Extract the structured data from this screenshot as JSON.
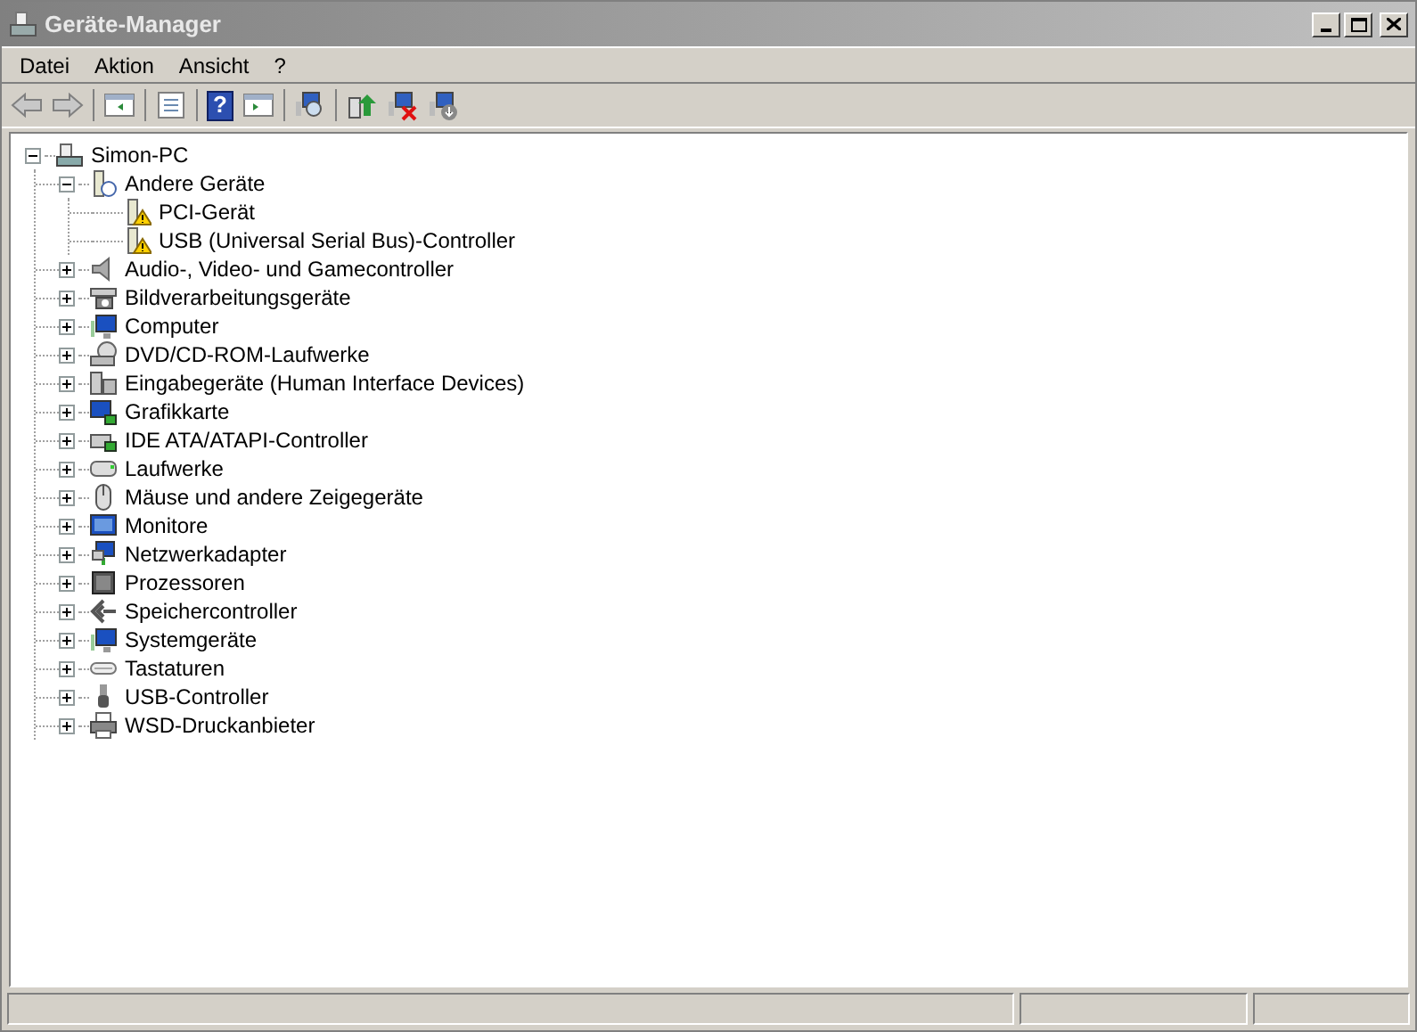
{
  "window": {
    "title": "Geräte-Manager",
    "active": false
  },
  "menu": [
    "Datei",
    "Aktion",
    "Ansicht",
    "?"
  ],
  "toolbar": {
    "help_glyph": "?"
  },
  "tree": [
    {
      "label": "Simon-PC",
      "expanded": true,
      "children": [
        {
          "label": "Andere Geräte",
          "expanded": true,
          "children": [
            {
              "label": "PCI-Gerät",
              "warning": true
            },
            {
              "label": "USB (Universal Serial Bus)-Controller",
              "warning": true
            }
          ]
        },
        {
          "label": "Audio-, Video- und Gamecontroller",
          "expanded": false
        },
        {
          "label": "Bildverarbeitungsgeräte",
          "expanded": false
        },
        {
          "label": "Computer",
          "expanded": false
        },
        {
          "label": "DVD/CD-ROM-Laufwerke",
          "expanded": false
        },
        {
          "label": "Eingabegeräte (Human Interface Devices)",
          "expanded": false
        },
        {
          "label": "Grafikkarte",
          "expanded": false
        },
        {
          "label": "IDE ATA/ATAPI-Controller",
          "expanded": false
        },
        {
          "label": "Laufwerke",
          "expanded": false
        },
        {
          "label": "Mäuse und andere Zeigegeräte",
          "expanded": false
        },
        {
          "label": "Monitore",
          "expanded": false
        },
        {
          "label": "Netzwerkadapter",
          "expanded": false
        },
        {
          "label": "Prozessoren",
          "expanded": false
        },
        {
          "label": "Speichercontroller",
          "expanded": false
        },
        {
          "label": "Systemgeräte",
          "expanded": false
        },
        {
          "label": "Tastaturen",
          "expanded": false
        },
        {
          "label": "USB-Controller",
          "expanded": false
        },
        {
          "label": "WSD-Druckanbieter",
          "expanded": false
        }
      ]
    }
  ]
}
